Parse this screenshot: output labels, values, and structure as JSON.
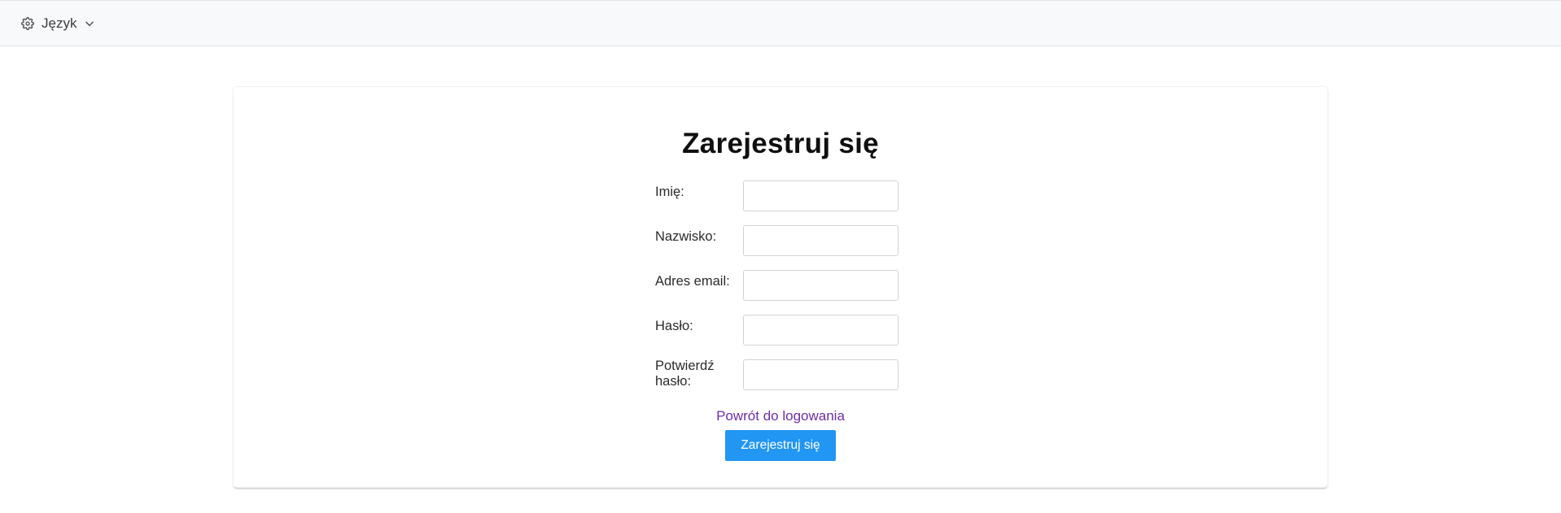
{
  "topbar": {
    "language_label": "Język",
    "language_icon": "gear-icon",
    "dropdown_icon": "chevron-down-icon"
  },
  "form": {
    "title": "Zarejestruj się",
    "fields": [
      {
        "label": "Imię:",
        "value": ""
      },
      {
        "label": "Nazwisko:",
        "value": ""
      },
      {
        "label": "Adres email:",
        "value": ""
      },
      {
        "label": "Hasło:",
        "value": ""
      },
      {
        "label": "Potwierdź hasło:",
        "value": ""
      }
    ],
    "back_link": "Powrót do logowania",
    "submit_label": "Zarejestruj się"
  },
  "colors": {
    "primary_button": "#2196f3",
    "link": "#6f2da8",
    "topbar_bg": "#f8f9fb"
  }
}
